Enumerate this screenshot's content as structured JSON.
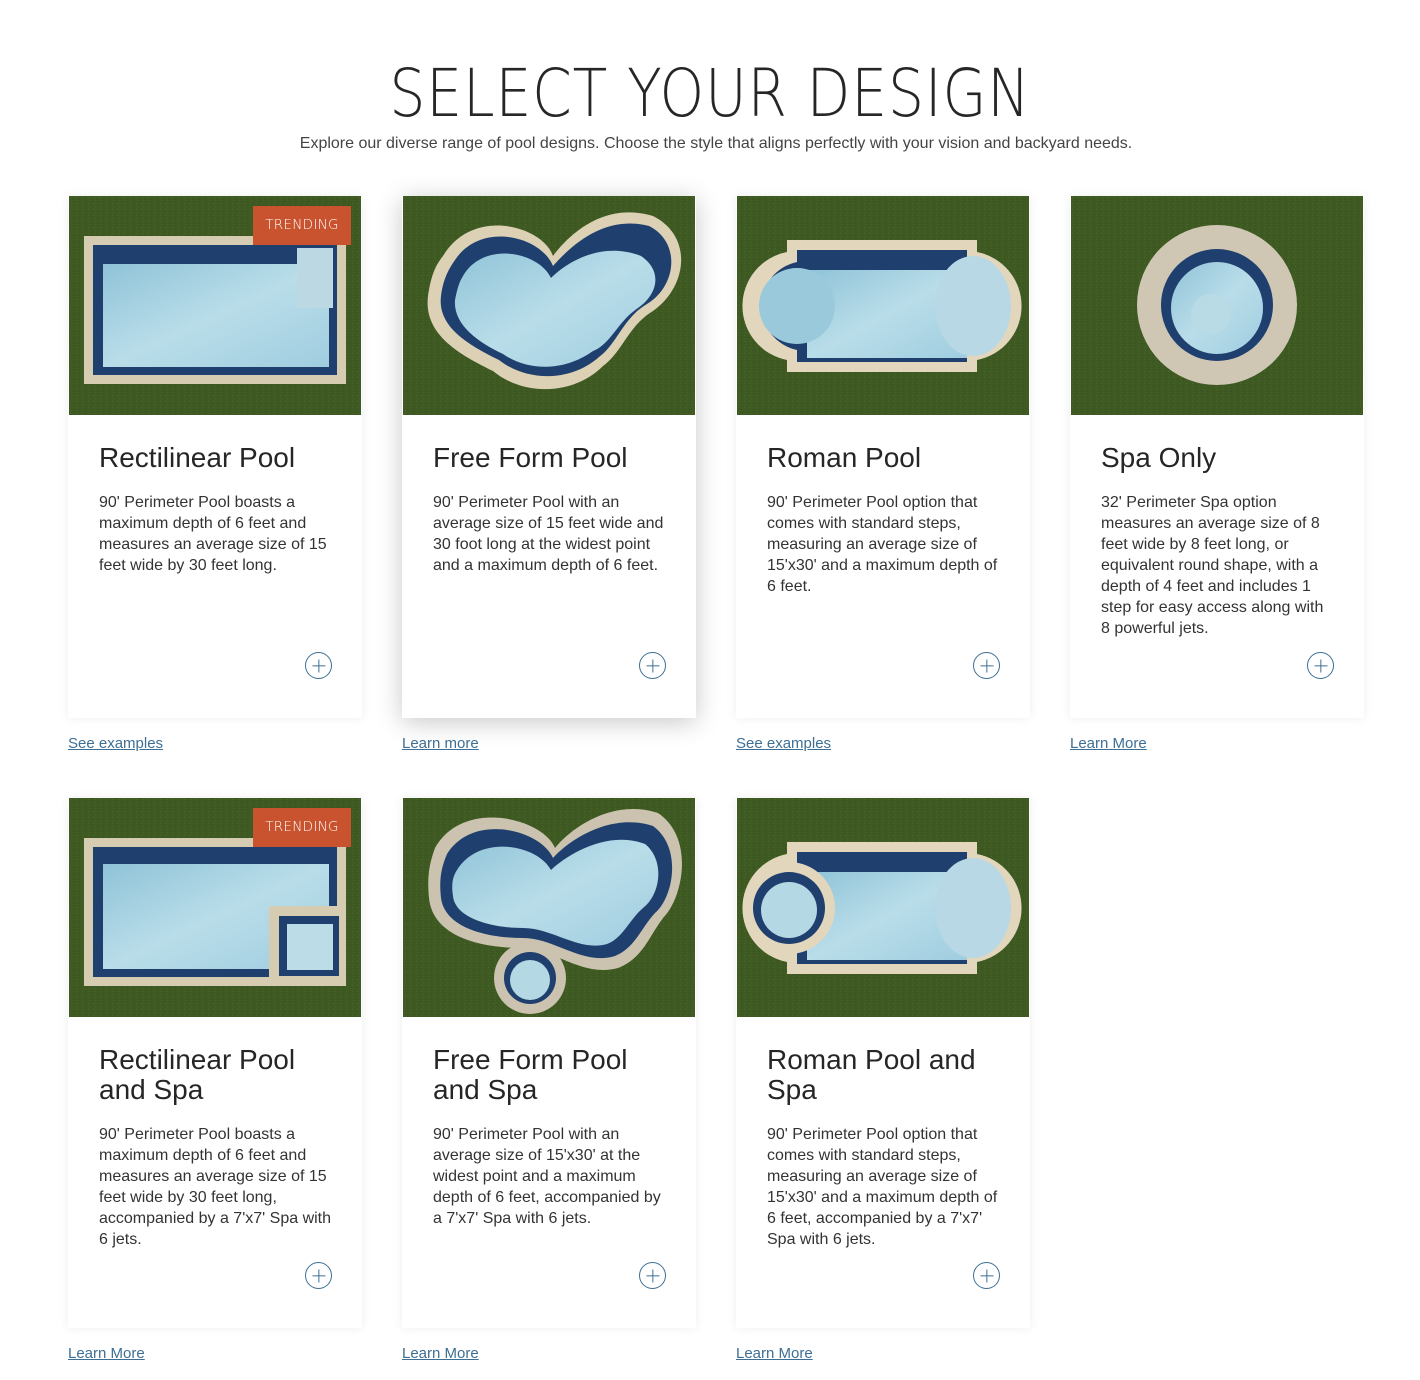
{
  "header": {
    "title": "SELECT YOUR DESIGN",
    "subtitle": "Explore our diverse range of pool designs. Choose the style that aligns perfectly with your vision and backyard needs."
  },
  "colors": {
    "accent_link": "#3d6f94",
    "badge": "#c9532e",
    "grass": "#3e5a22",
    "water": "#a9d3e3",
    "coping": "#d8cfb7"
  },
  "cards": [
    {
      "title": "Rectilinear Pool",
      "description": "90' Perimeter Pool boasts a maximum depth of 6 feet and measures an average size of 15 feet wide by 30 feet long.",
      "badge": "TRENDING",
      "link": "See examples",
      "icon": "plus-circle-icon"
    },
    {
      "title": "Free Form Pool",
      "description": "90' Perimeter Pool with an average size of 15 feet wide and 30 foot long at the widest point and a maximum depth of 6 feet.",
      "badge": "",
      "link": "Learn more",
      "icon": "plus-circle-icon"
    },
    {
      "title": "Roman Pool",
      "description": "90' Perimeter Pool option that comes with standard steps, measuring an average size of 15'x30' and a maximum depth of 6 feet.",
      "badge": "",
      "link": "See examples",
      "icon": "plus-circle-icon"
    },
    {
      "title": "Spa Only",
      "description": "32' Perimeter Spa option measures an average size of 8 feet wide by 8 feet long, or equivalent round shape, with a depth of 4 feet and includes 1 step for easy access along with 8 powerful jets.",
      "badge": "",
      "link": "Learn More",
      "icon": "plus-circle-icon"
    },
    {
      "title": "Rectilinear Pool and Spa",
      "description": "90' Perimeter Pool boasts a maximum depth of 6 feet and measures an average size of 15 feet wide by 30 feet long, accompanied by a 7'x7' Spa with 6 jets.",
      "badge": "TRENDING",
      "link": "Learn More",
      "icon": "plus-circle-icon"
    },
    {
      "title": "Free Form Pool and Spa",
      "description": "90' Perimeter Pool with an average size of 15'x30' at the widest point and a maximum depth of 6 feet, accompanied by a 7'x7' Spa with 6 jets.",
      "badge": "",
      "link": "Learn More",
      "icon": "plus-circle-icon"
    },
    {
      "title": "Roman Pool and Spa",
      "description": "90' Perimeter Pool option that comes with standard steps, measuring an average size of 15'x30' and a maximum depth of 6 feet, accompanied by a 7'x7' Spa with 6 jets.",
      "badge": "",
      "link": "Learn More",
      "icon": "plus-circle-icon"
    }
  ]
}
